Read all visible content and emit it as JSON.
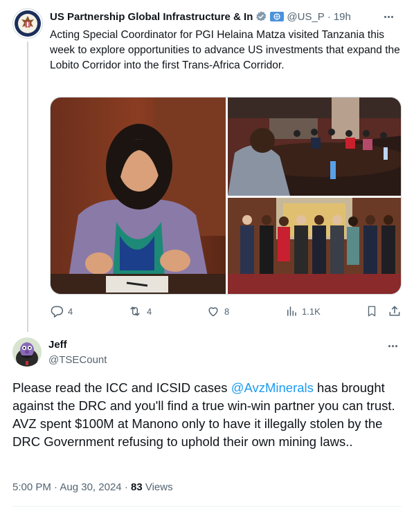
{
  "tweet": {
    "author_name": "US Partnership Global Infrastructure & In",
    "author_handle": "@US_P",
    "time_ago": "19h",
    "separator": "·",
    "text": "Acting Special Coordinator for PGI Helaina Matza visited Tanzania this week to explore opportunities to advance US investments that expand the Lobito Corridor into the first Trans-Africa Corridor.",
    "icons": {
      "avatar": "us-state-department-seal-icon",
      "verified": "gray-verified-badge-icon",
      "flag": "un-flag-icon",
      "more": "more-options-icon"
    },
    "media": [
      {
        "name": "photo-woman-speaking-at-table"
      },
      {
        "name": "photo-meeting-conference-table"
      },
      {
        "name": "photo-group-standing-portrait"
      }
    ],
    "actions": {
      "reply_count": "4",
      "retweet_count": "4",
      "like_count": "8",
      "views_count": "1.1K"
    }
  },
  "reply": {
    "author_name": "Jeff",
    "author_handle": "@TSECount",
    "text_before": "Please read the ICC and ICSID cases ",
    "mention": "@AvzMinerals",
    "text_after": " has brought against the DRC and you'll find a true win-win partner you can trust. AVZ spent $100M at Manono only to have it illegally stolen by the DRC Government refusing to uphold their own mining laws..",
    "time": "5:00 PM",
    "date": "Aug 30, 2024",
    "views": "83",
    "views_label": "Views",
    "icons": {
      "avatar": "count-muppet-avatar-icon",
      "more": "more-options-icon"
    }
  },
  "colors": {
    "text": "#0f1419",
    "secondary": "#536471",
    "link": "#1d9bf0",
    "line": "#cfd9de"
  }
}
